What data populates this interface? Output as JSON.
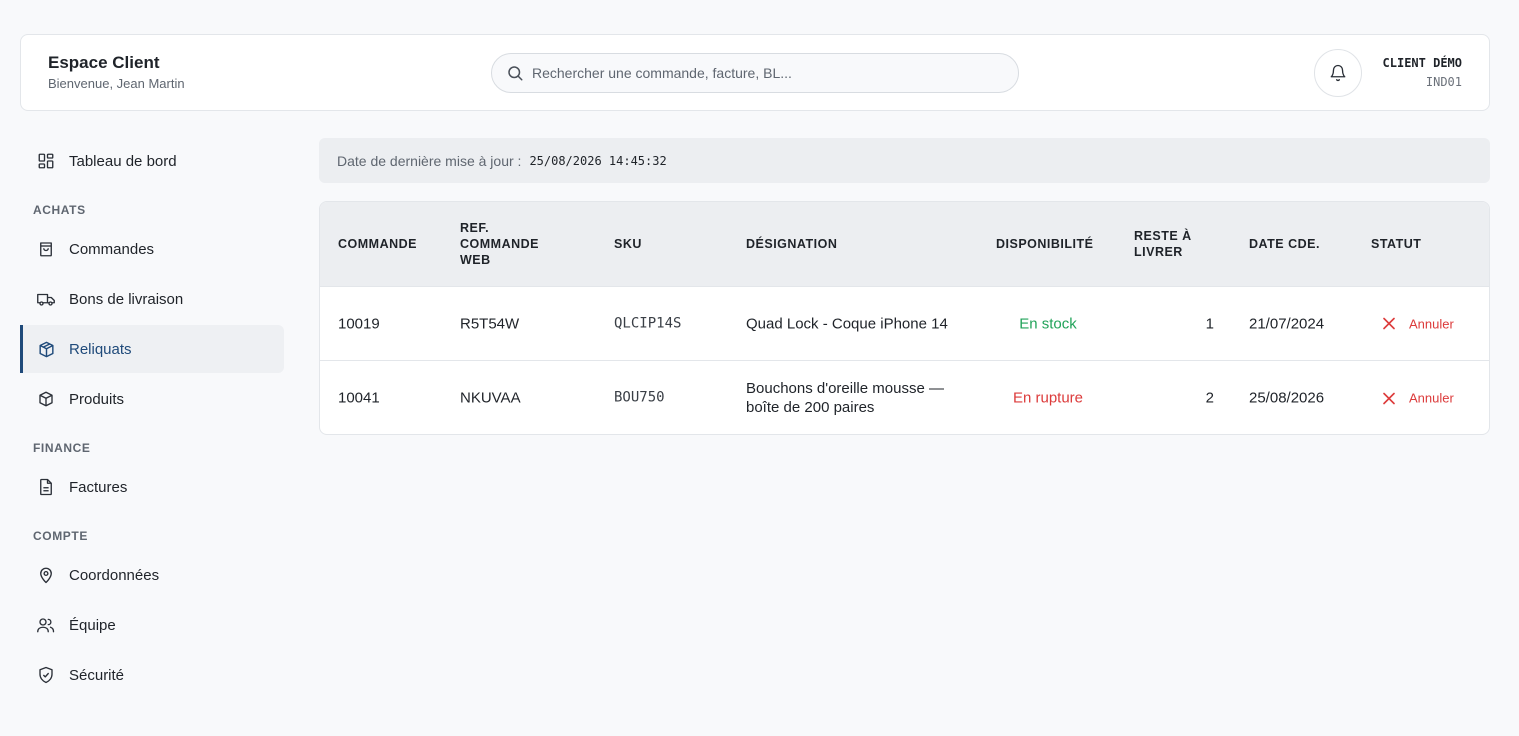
{
  "header": {
    "title": "Espace Client",
    "subtitle": "Bienvenue, Jean Martin",
    "search_placeholder": "Rechercher une commande, facture, BL...",
    "client_name": "CLIENT DÉMO",
    "client_code": "IND01"
  },
  "sidebar": {
    "top_item": "Tableau de bord",
    "sections": [
      {
        "label": "ACHATS",
        "items": [
          "Commandes",
          "Bons de livraison",
          "Reliquats",
          "Produits"
        ]
      },
      {
        "label": "FINANCE",
        "items": [
          "Factures"
        ]
      },
      {
        "label": "COMPTE",
        "items": [
          "Coordonnées",
          "Équipe",
          "Sécurité"
        ]
      }
    ],
    "active": "Reliquats"
  },
  "update": {
    "label": "Date de dernière mise à jour :",
    "timestamp": "25/08/2026 14:45:32"
  },
  "table": {
    "columns": {
      "commande": "COMMANDE",
      "ref1": "REF.",
      "ref2": "COMMANDE",
      "ref3": "WEB",
      "sku": "SKU",
      "designation": "DÉSIGNATION",
      "disponibilite": "DISPONIBILITÉ",
      "reste1": "RESTE À",
      "reste2": "LIVRER",
      "date": "DATE CDE.",
      "statut": "STATUT"
    },
    "rows": [
      {
        "commande": "10019",
        "ref_web": "R5T54W",
        "sku": "QLCIP14S",
        "designation": "Quad Lock - Coque iPhone 14",
        "disponibilite": "En stock",
        "reste": "1",
        "date": "21/07/2024",
        "action": "Annuler"
      },
      {
        "commande": "10041",
        "ref_web": "NKUVAA",
        "sku": "BOU750",
        "designation": "Bouchons d'oreille mousse — boîte de 200 paires",
        "disponibilite": "En rupture",
        "reste": "2",
        "date": "25/08/2026",
        "action": "Annuler"
      }
    ]
  },
  "colors": {
    "accent": "#1f4a7a",
    "in_stock": "#22a35a",
    "out_of_stock": "#dc3b3b"
  }
}
